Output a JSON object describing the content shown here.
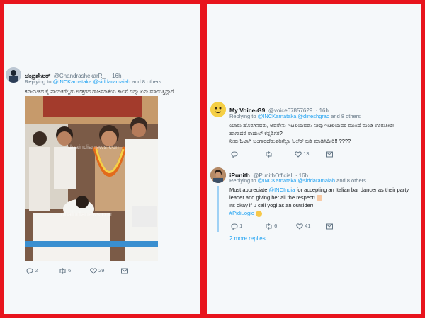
{
  "left_tweet": {
    "display_name": "ಚಂದ್ರಶೇಖರ್",
    "handle": "@ChandrashekarR_",
    "time": "· 16h",
    "replying_prefix": "Replying to",
    "mentions": "@INCKarnataka @siddaramaiah",
    "others": "and 8 others",
    "text": "ಕರ್ನಾಟಕದ ಕೈ ನಾಯಕರೆಲ್ಲರು ಉತ್ತರದ ರಾಜಮಾತೆಯ ಕಾಲಿಗೆ ಬಿದ್ದು ಏನು ಮಾಡುತ್ತಿದ್ದಾರೆ.",
    "watermark": "dnaindianews.com",
    "reply_count": "2",
    "retweet_count": "6",
    "like_count": "29"
  },
  "right_tweet_1": {
    "display_name": "My Voice-G9",
    "handle": "@voice67857629",
    "time": "· 16h",
    "replying_prefix": "Replying to",
    "mentions": "@INCKarnataka @dineshgrao",
    "others": "and 8 others",
    "line1": "ಯಾರು ಹೊರಗಿನವರು, ಅವರೇನು ಇಟಲಿಯವರ? ನೀವು ಇಟಲಿಯವರ ಮುಂದೆ ಮಂಡಿ ಊರುತೀರಿ!",
    "line2": "ಹಾಗಾದರೆ ರಾಹುಲ್ ಕನ್ನಡಿಗರ?",
    "line3": "ನೀವು ಓಟಾಗಿ ಬಂಗಾರದೆಡುವರಿಗೆಲ್ಲಾ ಓಲೆ‌ರ್ ಬಡಿ ಮಾಡಿಸಿದೀರಿ!!   ????",
    "reply_count": "",
    "retweet_count": "",
    "like_count": "13"
  },
  "right_tweet_2": {
    "display_name": "iPunith",
    "handle": "@PunithOfficial",
    "time": "· 16h",
    "replying_prefix": "Replying to",
    "mentions": "@INCKarnataka @siddaramaiah",
    "others": "and 8 others",
    "line1_pre": "Must appreciate ",
    "line1_mention": "@INCIndia",
    "line1_post": " for accepting an Italian bar dancer as their party",
    "line2": "leader and giving her all the respect!",
    "line3": "Its okay if u call yogi as an outsider!",
    "hashtag": "#PidiLogic",
    "reply_count": "1",
    "retweet_count": "6",
    "like_count": "41",
    "more_replies": "2 more replies"
  },
  "colors": {
    "border": "#e8141d",
    "link": "#1da1f2",
    "muted": "#657786",
    "background": "#f5f8fa"
  }
}
